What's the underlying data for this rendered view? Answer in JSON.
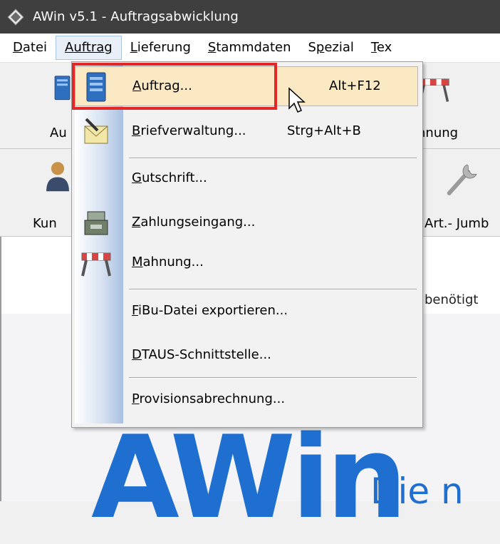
{
  "window": {
    "title": "AWin v5.1 - Auftragsabwicklung"
  },
  "menubar": {
    "items": [
      {
        "label": "Datei",
        "mnemonic": "D",
        "rest": "atei"
      },
      {
        "label": "Auftrag",
        "mnemonic": "A",
        "rest": "uftrag"
      },
      {
        "label": "Lieferung",
        "mnemonic": "L",
        "rest": "ieferung"
      },
      {
        "label": "Stammdaten",
        "mnemonic": "S",
        "rest": "tammdaten"
      },
      {
        "label": "Spezial",
        "pre": "S",
        "mnemonic": "p",
        "rest": "ezial"
      },
      {
        "label": "Text",
        "mnemonic": "T",
        "rest": "ex"
      }
    ]
  },
  "toolbar": {
    "row1": {
      "left_label": "Au",
      "right_label": "nnung"
    },
    "row2": {
      "left_label": "Kun",
      "right_label": "Art.- Jumb"
    }
  },
  "content": {
    "visible_text": "benötigt",
    "logo_text": "AWin",
    "slogan_text": "Die n"
  },
  "dropdown": {
    "items": [
      {
        "mnemonic": "A",
        "rest": "uftrag...",
        "shortcut": "Alt+F12",
        "icon": "server-icon",
        "highlighted": true
      },
      {
        "mnemonic": "B",
        "rest": "riefverwaltung...",
        "shortcut": "Strg+Alt+B",
        "icon": "envelope-pencil-icon"
      },
      {
        "mnemonic": "G",
        "rest": "utschrift...",
        "shortcut": ""
      },
      {
        "mnemonic": "Z",
        "rest": "ahlungseingang...",
        "shortcut": "",
        "icon": "cash-register-icon"
      },
      {
        "mnemonic": "M",
        "rest": "ahnung...",
        "shortcut": "",
        "icon": "barrier-icon"
      },
      {
        "mnemonic": "F",
        "rest": "iBu-Datei exportieren...",
        "shortcut": ""
      },
      {
        "mnemonic": "D",
        "rest": "TAUS-Schnittstelle...",
        "shortcut": ""
      },
      {
        "mnemonic": "P",
        "rest": "rovisionsabrechnung...",
        "shortcut": ""
      }
    ]
  },
  "colors": {
    "titlebar_bg": "#3f3f3f",
    "highlight_bg": "#fbe9c4",
    "annotation_red": "#e32626",
    "logo_blue": "#1e6fd0"
  }
}
